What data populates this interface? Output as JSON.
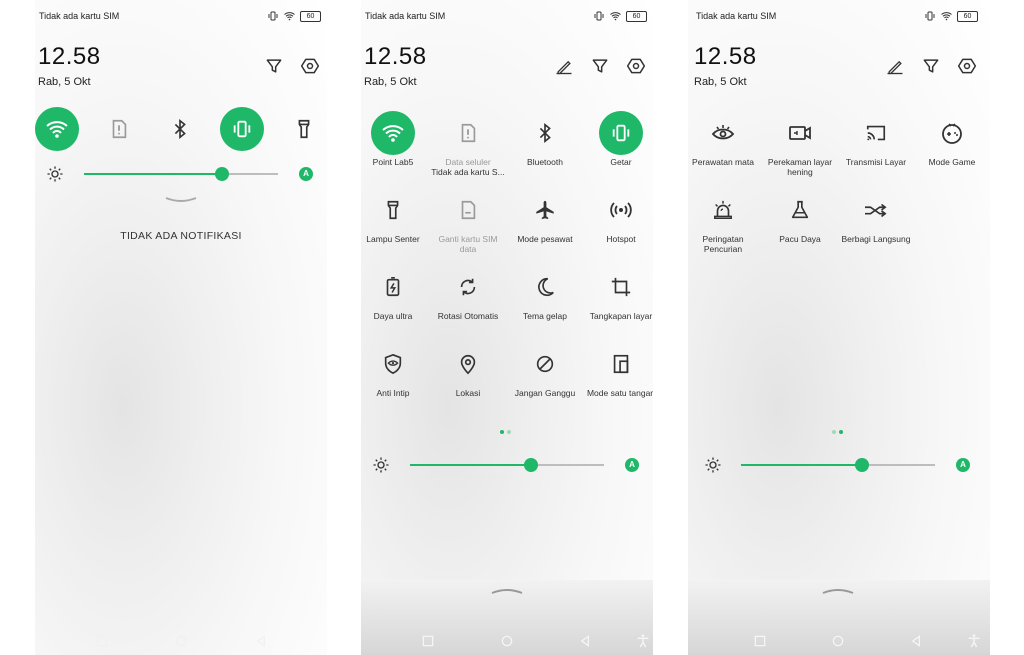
{
  "status": {
    "carrier": "Tidak ada kartu SIM",
    "battery": "60"
  },
  "header": {
    "time": "12.58",
    "date": "Rab, 5 Okt"
  },
  "panel1": {
    "empty_message": "TIDAK ADA NOTIFIKASI"
  },
  "panel2": {
    "tiles": [
      {
        "label": "Point Lab5"
      },
      {
        "label": "Data seluler",
        "sub": "Tidak ada kartu S..."
      },
      {
        "label": "Bluetooth"
      },
      {
        "label": "Getar"
      },
      {
        "label": "Lampu Senter"
      },
      {
        "label": "Ganti kartu SIM data"
      },
      {
        "label": "Mode pesawat"
      },
      {
        "label": "Hotspot"
      },
      {
        "label": "Daya ultra"
      },
      {
        "label": "Rotasi Otomatis"
      },
      {
        "label": "Tema gelap"
      },
      {
        "label": "Tangkapan layar"
      },
      {
        "label": "Anti Intip"
      },
      {
        "label": "Lokasi"
      },
      {
        "label": "Jangan Ganggu"
      },
      {
        "label": "Mode satu tangan"
      }
    ]
  },
  "panel3": {
    "tiles": [
      {
        "label": "Perawatan mata"
      },
      {
        "label": "Perekaman layar hening"
      },
      {
        "label": "Transmisi Layar"
      },
      {
        "label": "Mode Game"
      },
      {
        "label": "Peringatan Pencurian"
      },
      {
        "label": "Pacu Daya"
      },
      {
        "label": "Berbagi Langsung"
      }
    ]
  },
  "brightness": {
    "level": 0.71,
    "auto_label": "A"
  },
  "colors": {
    "accent": "#1fb768"
  },
  "icons": [
    "wifi-icon",
    "sim-icon",
    "bluetooth-icon",
    "vibrate-icon",
    "flashlight-icon",
    "airplane-icon",
    "hotspot-icon",
    "battery-saver-icon",
    "rotate-icon",
    "moon-icon",
    "crop-icon",
    "shield-eye-icon",
    "location-icon",
    "dnd-icon",
    "one-hand-icon",
    "eye-icon",
    "screen-record-icon",
    "cast-icon",
    "gamepad-icon",
    "alarm-icon",
    "flask-icon",
    "share-icon",
    "edit-icon",
    "filter-icon",
    "settings-icon",
    "sun-icon",
    "back-icon",
    "home-icon",
    "recents-icon",
    "accessibility-icon"
  ]
}
